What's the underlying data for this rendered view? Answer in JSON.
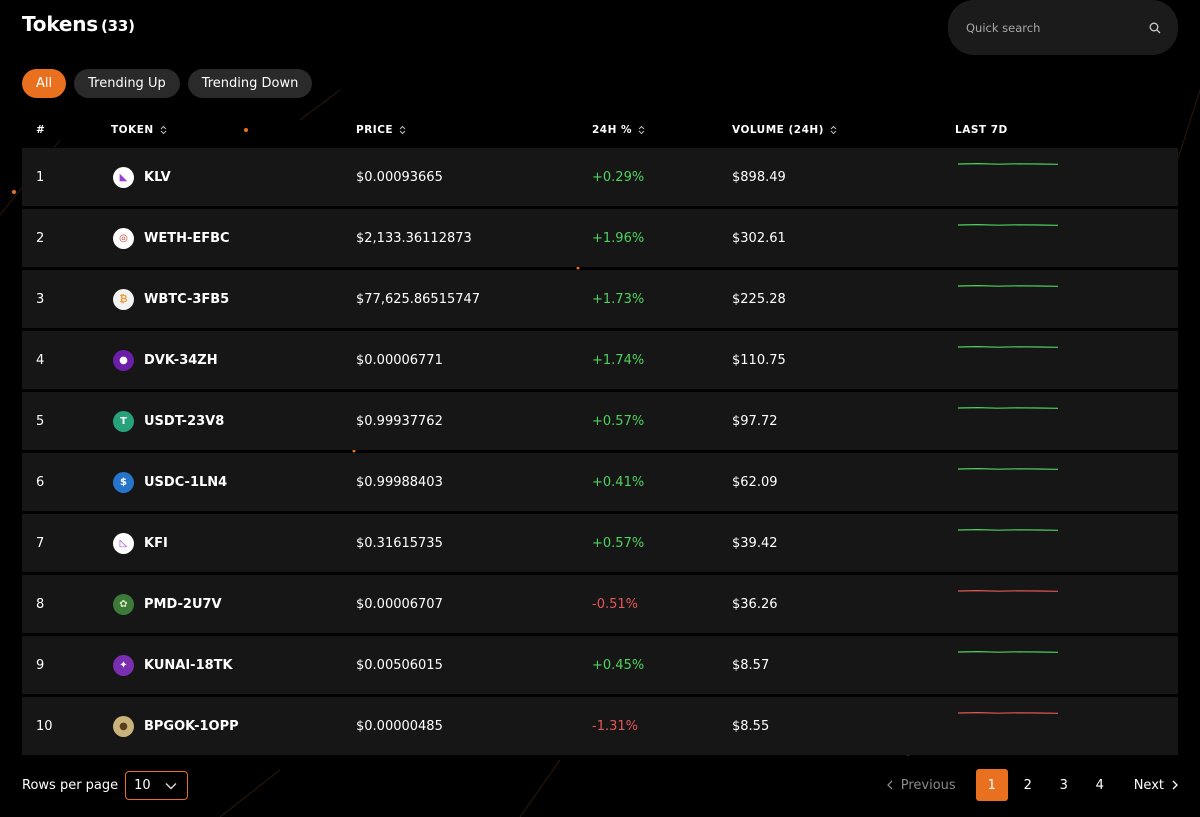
{
  "header": {
    "title": "Tokens",
    "count": "(33)"
  },
  "search": {
    "placeholder": "Quick search"
  },
  "filters": [
    "All",
    "Trending Up",
    "Trending Down"
  ],
  "columns": {
    "num": "#",
    "token": "TOKEN",
    "price": "PRICE",
    "change": "24H %",
    "volume": "VOLUME (24H)",
    "last7d": "LAST 7D"
  },
  "colors": {
    "accent": "#e8701e",
    "positive": "#4fd15e",
    "negative": "#e45757"
  },
  "rows": [
    {
      "num": "1",
      "token": "KLV",
      "icon": "klv-icon",
      "price": "$0.00093665",
      "change": "+0.29%",
      "trend": "up",
      "volume": "$898.49"
    },
    {
      "num": "2",
      "token": "WETH-EFBC",
      "icon": "weth-icon",
      "price": "$2,133.36112873",
      "change": "+1.96%",
      "trend": "up",
      "volume": "$302.61"
    },
    {
      "num": "3",
      "token": "WBTC-3FB5",
      "icon": "wbtc-icon",
      "price": "$77,625.86515747",
      "change": "+1.73%",
      "trend": "up",
      "volume": "$225.28"
    },
    {
      "num": "4",
      "token": "DVK-34ZH",
      "icon": "dvk-icon",
      "price": "$0.00006771",
      "change": "+1.74%",
      "trend": "up",
      "volume": "$110.75"
    },
    {
      "num": "5",
      "token": "USDT-23V8",
      "icon": "usdt-icon",
      "price": "$0.99937762",
      "change": "+0.57%",
      "trend": "up",
      "volume": "$97.72"
    },
    {
      "num": "6",
      "token": "USDC-1LN4",
      "icon": "usdc-icon",
      "price": "$0.99988403",
      "change": "+0.41%",
      "trend": "up",
      "volume": "$62.09"
    },
    {
      "num": "7",
      "token": "KFI",
      "icon": "kfi-icon",
      "price": "$0.31615735",
      "change": "+0.57%",
      "trend": "up",
      "volume": "$39.42"
    },
    {
      "num": "8",
      "token": "PMD-2U7V",
      "icon": "pmd-icon",
      "price": "$0.00006707",
      "change": "-0.51%",
      "trend": "down",
      "volume": "$36.26"
    },
    {
      "num": "9",
      "token": "KUNAI-18TK",
      "icon": "kunai-icon",
      "price": "$0.00506015",
      "change": "+0.45%",
      "trend": "up",
      "volume": "$8.57"
    },
    {
      "num": "10",
      "token": "BPGOK-1OPP",
      "icon": "bpgok-icon",
      "price": "$0.00000485",
      "change": "-1.31%",
      "trend": "down",
      "volume": "$8.55"
    }
  ],
  "footer": {
    "rows_per_page_label": "Rows per page",
    "rows_per_page_value": "10",
    "prev_label": "Previous",
    "next_label": "Next",
    "pages": [
      "1",
      "2",
      "3",
      "4"
    ],
    "current_page": "1"
  }
}
